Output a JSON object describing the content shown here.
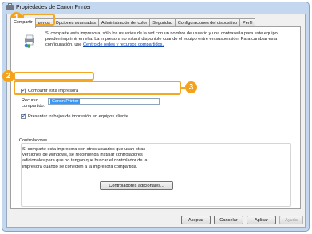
{
  "window": {
    "title": "Propiedades de Canon Printer"
  },
  "tabs": [
    {
      "label": "Compartir",
      "active": true
    },
    {
      "label": "uertos",
      "active": false
    },
    {
      "label": "Opciones avanzadas",
      "active": false
    },
    {
      "label": "Administración del color",
      "active": false
    },
    {
      "label": "Seguridad",
      "active": false
    },
    {
      "label": "Configuraciones del dispositivo",
      "active": false
    },
    {
      "label": "Perfil",
      "active": false
    }
  ],
  "intro": {
    "text": "Si comparte esta impresora, sólo los usuarios de la red con un nombre de usuario y una contraseña para este equipo pueden imprimir en ella. La impresora no estará disponible cuando el equipo entre en suspensión. Para cambiar esta configuración, use ",
    "link": "Centro de redes y recursos compartidos."
  },
  "share_checkbox": {
    "label": "Compartir esta impresora",
    "checked": true
  },
  "share_name": {
    "label": "Recurso compartido:",
    "value": "Canon Printer"
  },
  "render_checkbox": {
    "label": "Presentar trabajos de impresión en equipos cliente",
    "checked": true
  },
  "drivers": {
    "title": "Controladores",
    "text": "Si comparte esta impresora con otros usuarios que usan otras versiones de Windows, se recomienda instalar controladores adicionales para que no tengan que buscar el controlador de la impresora cuando se conecten a la impresora compartida.",
    "button": "Controladores adicionales..."
  },
  "footer": {
    "accept": "Aceptar",
    "cancel": "Cancelar",
    "apply": "Aplicar",
    "help": "Ayuda"
  },
  "callouts": [
    "1",
    "2",
    "3"
  ],
  "colors": {
    "callout": "#f4a21c",
    "link": "#0b44b3",
    "selection": "#3399ff"
  }
}
